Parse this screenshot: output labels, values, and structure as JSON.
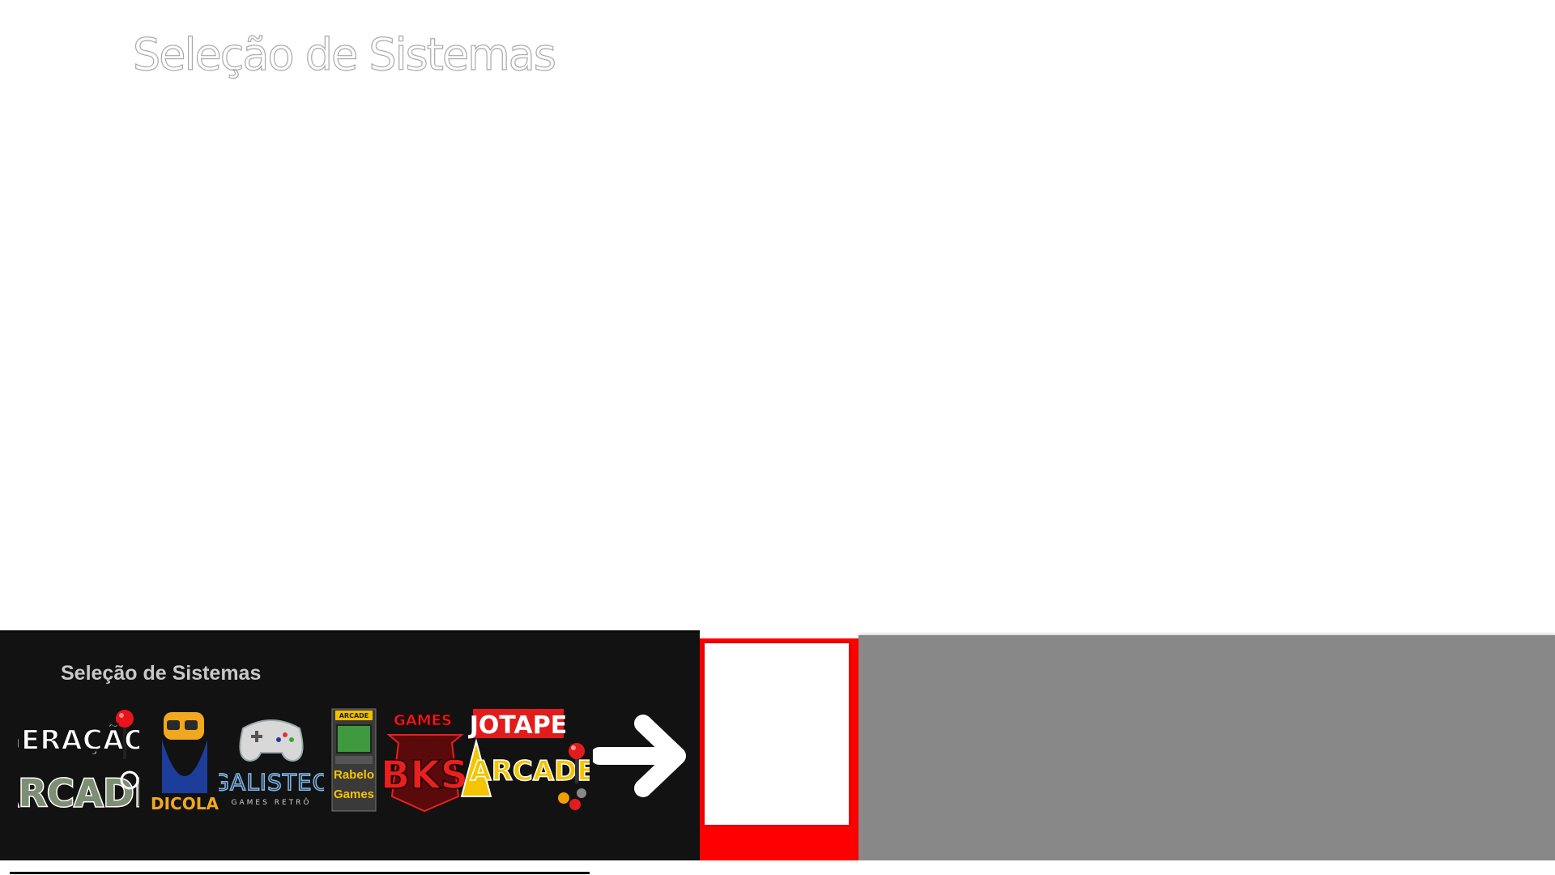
{
  "header": {
    "title": "Seleção de Sistemas"
  },
  "panel": {
    "heading": "Seleção de Sistemas"
  },
  "logos": [
    {
      "name": "geracao-arcade",
      "line1": "GERAÇÃO",
      "line2": "ARCADE"
    },
    {
      "name": "dicola",
      "text": "DICOLA"
    },
    {
      "name": "galisteo",
      "text": "GALISTEO",
      "sub": "GAMES RETRÔ"
    },
    {
      "name": "rabelo-games",
      "top": "ARCADE",
      "line1": "Rabelo",
      "line2": "Games"
    },
    {
      "name": "bks",
      "top": "GAMES",
      "text": "BKS"
    },
    {
      "name": "jotape-arcade",
      "line1": "JOTAPE",
      "line2": "ARCADE"
    }
  ],
  "icons": {
    "next": "arrow-right-icon"
  },
  "colors": {
    "selected_border": "#ff0000",
    "grey_panel": "#888888",
    "dark_panel": "#121212",
    "title_outline": "#a9a9a9"
  }
}
